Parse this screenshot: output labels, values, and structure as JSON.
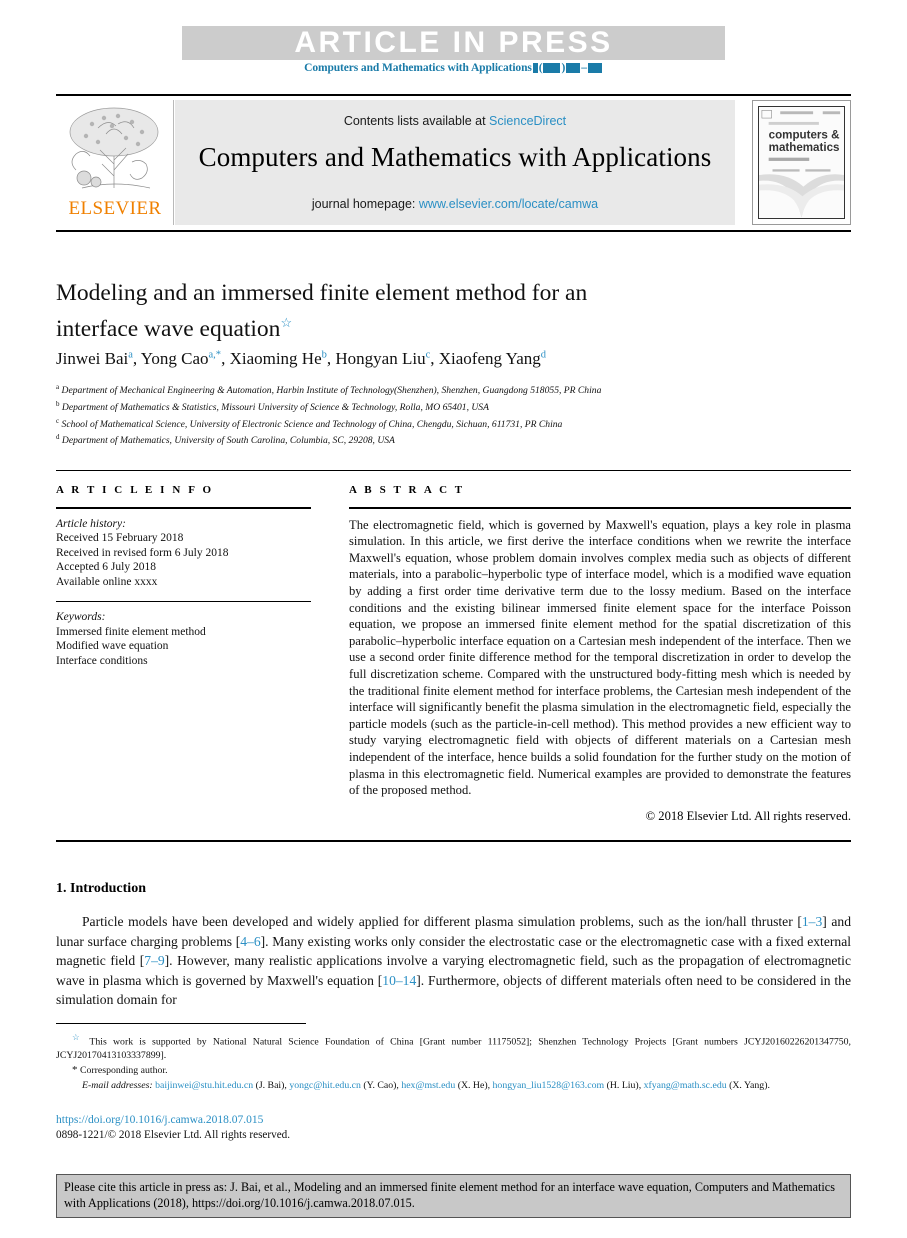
{
  "banner": {
    "text": "ARTICLE IN PRESS",
    "journal_ref_prefix": "Computers and Mathematics with Applications",
    "color": "#1a7ba8",
    "bg": "#cccccc"
  },
  "masthead": {
    "publisher": "ELSEVIER",
    "contents_prefix": "Contents lists available at ",
    "contents_link": "ScienceDirect",
    "journal_title": "Computers and Mathematics with Applications",
    "homepage_prefix": "journal homepage: ",
    "homepage_link": "www.elsevier.com/locate/camwa",
    "cover_lines": [
      "an International Journal",
      "computers &",
      "mathematics",
      "with applications"
    ],
    "link_color": "#2a8fc4"
  },
  "article": {
    "title_line1": "Modeling and an immersed finite element method for an",
    "title_line2": "interface wave equation",
    "title_mark": "☆",
    "authors": [
      {
        "name": "Jinwei Bai",
        "mark": "a"
      },
      {
        "name": "Yong Cao",
        "mark": "a,*"
      },
      {
        "name": "Xiaoming He",
        "mark": "b"
      },
      {
        "name": "Hongyan Liu",
        "mark": "c"
      },
      {
        "name": "Xiaofeng Yang",
        "mark": "d"
      }
    ],
    "affiliations": [
      {
        "mark": "a",
        "text": "Department of Mechanical Engineering & Automation, Harbin Institute of Technology(Shenzhen), Shenzhen, Guangdong 518055, PR China"
      },
      {
        "mark": "b",
        "text": "Department of Mathematics & Statistics, Missouri University of Science & Technology, Rolla, MO 65401, USA"
      },
      {
        "mark": "c",
        "text": "School of Mathematical Science, University of Electronic Science and Technology of China, Chengdu, Sichuan, 611731, PR China"
      },
      {
        "mark": "d",
        "text": "Department of Mathematics, University of South Carolina, Columbia, SC, 29208, USA"
      }
    ]
  },
  "info": {
    "heading": "A R T I C L E    I N F O",
    "history_label": "Article history:",
    "history": [
      "Received 15 February 2018",
      "Received in revised form 6 July 2018",
      "Accepted 6 July 2018",
      "Available online xxxx"
    ],
    "keywords_label": "Keywords:",
    "keywords": [
      "Immersed finite element method",
      "Modified wave equation",
      "Interface conditions"
    ]
  },
  "abstract": {
    "heading": "A B S T R A C T",
    "text": "The electromagnetic field, which is governed by Maxwell's equation, plays a key role in plasma simulation. In this article, we first derive the interface conditions when we rewrite the interface Maxwell's equation, whose problem domain involves complex media such as objects of different materials, into a parabolic–hyperbolic type of interface model, which is a modified wave equation by adding a first order time derivative term due to the lossy medium. Based on the interface conditions and the existing bilinear immersed finite element space for the interface Poisson equation, we propose an immersed finite element method for the spatial discretization of this parabolic–hyperbolic interface equation on a Cartesian mesh independent of the interface. Then we use a second order finite difference method for the temporal discretization in order to develop the full discretization scheme. Compared with the unstructured body-fitting mesh which is needed by the traditional finite element method for interface problems, the Cartesian mesh independent of the interface will significantly benefit the plasma simulation in the electromagnetic field, especially the particle models (such as the particle-in-cell method). This method provides a new efficient way to study varying electromagnetic field with objects of different materials on a Cartesian mesh independent of the interface, hence builds a solid foundation for the further study on the motion of plasma in this electromagnetic field. Numerical examples are provided to demonstrate the features of the proposed method.",
    "copyright": "© 2018 Elsevier Ltd. All rights reserved."
  },
  "introduction": {
    "heading": "1. Introduction",
    "p1_a": "Particle models have been developed and widely applied for different plasma simulation problems, such as the ion/hall thruster [",
    "ref1": "1–3",
    "p1_b": "] and lunar surface charging problems [",
    "ref2": "4–6",
    "p1_c": "]. Many existing works only consider the electrostatic case or the electromagnetic case with a fixed external magnetic field [",
    "ref3": "7–9",
    "p1_d": "]. However, many realistic applications involve a varying electromagnetic field, such as the propagation of electromagnetic wave in plasma which is governed by Maxwell's equation [",
    "ref4": "10–14",
    "p1_e": "]. Furthermore, objects of different materials often need to be considered in the simulation domain for"
  },
  "footnotes": {
    "funding_mark": "☆",
    "funding": "This work is supported by National Natural Science Foundation of China [Grant number 11175052]; Shenzhen Technology Projects [Grant numbers JCYJ20160226201347750, JCYJ20170413103337899].",
    "corresponding_mark": "*",
    "corresponding": "Corresponding author.",
    "email_label": "E-mail addresses:",
    "emails": [
      {
        "addr": "baijinwei@stu.hit.edu.cn",
        "who": "(J. Bai)"
      },
      {
        "addr": "yongc@hit.edu.cn",
        "who": "(Y. Cao)"
      },
      {
        "addr": "hex@mst.edu",
        "who": "(X. He)"
      },
      {
        "addr": "hongyan_liu1528@163.com",
        "who": "(H. Liu)"
      },
      {
        "addr": "xfyang@math.sc.edu",
        "who": "(X. Yang)"
      }
    ],
    "doi": "https://doi.org/10.1016/j.camwa.2018.07.015",
    "issn": "0898-1221/© 2018 Elsevier Ltd. All rights reserved."
  },
  "cite_box": {
    "text": "Please cite this article in press as: J. Bai, et al., Modeling and an immersed finite element method for an interface wave equation, Computers and Mathematics with Applications (2018), https://doi.org/10.1016/j.camwa.2018.07.015."
  }
}
